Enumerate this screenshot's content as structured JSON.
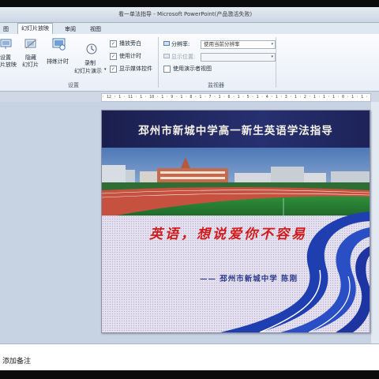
{
  "window": {
    "title": "看一单法指导 - Microsoft PowerPoint(产品激活失败)"
  },
  "tabs": [
    {
      "label": "图",
      "active": false
    },
    {
      "label": "幻灯片放映",
      "active": true
    },
    {
      "label": "审阅",
      "active": false
    },
    {
      "label": "视图",
      "active": false
    }
  ],
  "ribbon": {
    "setup_show": "设置",
    "setup_show2": "片放映",
    "hide_slide": "隐藏",
    "hide_slide2": "幻灯片",
    "rehearse": "排练计时",
    "record": "录制",
    "record2": "幻灯片演示",
    "play_narrations": "播放旁白",
    "use_timings": "使用计时",
    "show_media_controls": "显示媒体控件",
    "group_setup": "设置",
    "resolution_label": "分辨率:",
    "resolution_value": "使用当前分辨率",
    "show_on_label": "显示位置:",
    "show_on_value": "",
    "presenter_view": "使用演示者视图",
    "group_monitors": "监视器",
    "checks": {
      "play_narrations": true,
      "use_timings": true,
      "show_media_controls": true,
      "presenter_view": false
    }
  },
  "ruler": {
    "text": "· 12 · 1 · 11 · 1 · 10 · 1 · 9 · 1 · 8 · 1 · 7 · 1 · 6 · 1 · 5 · 1 · 4 · 1 · 3 · 1 · 2 · 1 · 1 · 1 · 0 · 1 · 1 · 1 · 2 · 1 · 3 · 1 · 4 · 1 · 5 · 1 · 6 · 1 · 7 · 1 · 8 · 1 · 9 · 1 · 10 · 1 · 11 · 1 · 12 ·"
  },
  "slide": {
    "title": "邳州市新城中学高一新生英语学法指导",
    "slogan": "英语，想说爱你不容易",
    "author": "—— 邳州市新城中学 陈刚"
  },
  "notes": {
    "placeholder": "添加备注"
  },
  "colors": {
    "title_band": "#1a1f4d",
    "slogan_red": "#d21a1a",
    "author_blue": "#2b3a8c",
    "swoosh_blue": "#1f3fb0"
  }
}
